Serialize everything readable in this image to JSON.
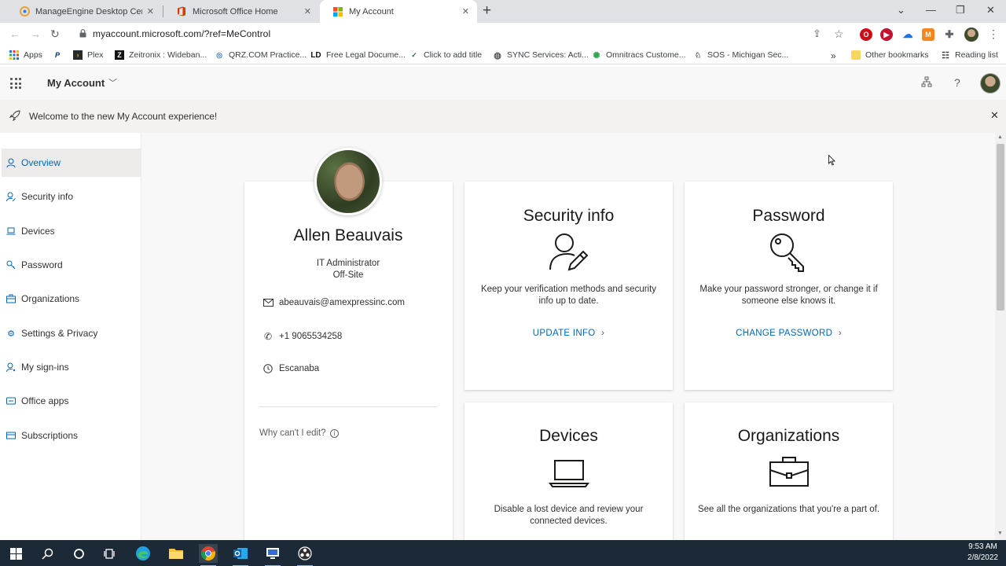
{
  "browser": {
    "tabs": [
      {
        "title": "ManageEngine Desktop Central",
        "active": false
      },
      {
        "title": "Microsoft Office Home",
        "active": false
      },
      {
        "title": "My Account",
        "active": true
      }
    ],
    "url": "myaccount.microsoft.com/?ref=MeControl",
    "bookmarks": [
      {
        "label": "Apps",
        "icon": "apps-grid-icon"
      },
      {
        "label": "",
        "icon": "paypal-icon"
      },
      {
        "label": "Plex",
        "icon": "plex-icon"
      },
      {
        "label": "Zeitronix : Wideban...",
        "icon": "zeitronix-icon"
      },
      {
        "label": "QRZ.COM Practice...",
        "icon": "qrz-icon"
      },
      {
        "label": "Free Legal Docume...",
        "icon": "ld-icon"
      },
      {
        "label": "Click to add title",
        "icon": "checkmark-icon"
      },
      {
        "label": "SYNC Services: Acti...",
        "icon": "globe-icon"
      },
      {
        "label": "Omnitracs Custome...",
        "icon": "omnitracs-icon"
      },
      {
        "label": "SOS - Michigan Sec...",
        "icon": "sos-icon"
      }
    ],
    "overflow": "»",
    "other_bookmarks": "Other bookmarks",
    "reading_list": "Reading list"
  },
  "app": {
    "title": "My Account"
  },
  "notice": {
    "text": "Welcome to the new My Account experience!"
  },
  "sidebar": {
    "items": [
      {
        "label": "Overview",
        "icon": "person-icon",
        "active": true
      },
      {
        "label": "Security info",
        "icon": "security-person-icon",
        "active": false
      },
      {
        "label": "Devices",
        "icon": "laptop-icon",
        "active": false
      },
      {
        "label": "Password",
        "icon": "key-icon",
        "active": false
      },
      {
        "label": "Organizations",
        "icon": "briefcase-icon",
        "active": false
      },
      {
        "label": "Settings & Privacy",
        "icon": "gear-icon",
        "active": false
      },
      {
        "label": "My sign-ins",
        "icon": "signin-icon",
        "active": false
      },
      {
        "label": "Office apps",
        "icon": "office-icon",
        "active": false
      },
      {
        "label": "Subscriptions",
        "icon": "card-icon",
        "active": false
      }
    ]
  },
  "profile": {
    "name": "Allen Beauvais",
    "job_title": "IT Administrator",
    "office": "Off-Site",
    "email": "abeauvais@amexpressinc.com",
    "phone": "+1 9065534258",
    "location": "Escanaba",
    "why_edit": "Why can't I edit?"
  },
  "cards": {
    "security": {
      "title": "Security info",
      "desc": "Keep your verification methods and security info up to date.",
      "link": "UPDATE INFO"
    },
    "password": {
      "title": "Password",
      "desc": "Make your password stronger, or change it if someone else knows it.",
      "link": "CHANGE PASSWORD"
    },
    "devices": {
      "title": "Devices",
      "desc": "Disable a lost device and review your connected devices."
    },
    "organizations": {
      "title": "Organizations",
      "desc": "See all the organizations that you're a part of."
    }
  },
  "taskbar": {
    "time": "9:53 AM",
    "date": "2/8/2022"
  },
  "colors": {
    "accent": "#0067b8",
    "taskbar": "#1c2a37"
  }
}
